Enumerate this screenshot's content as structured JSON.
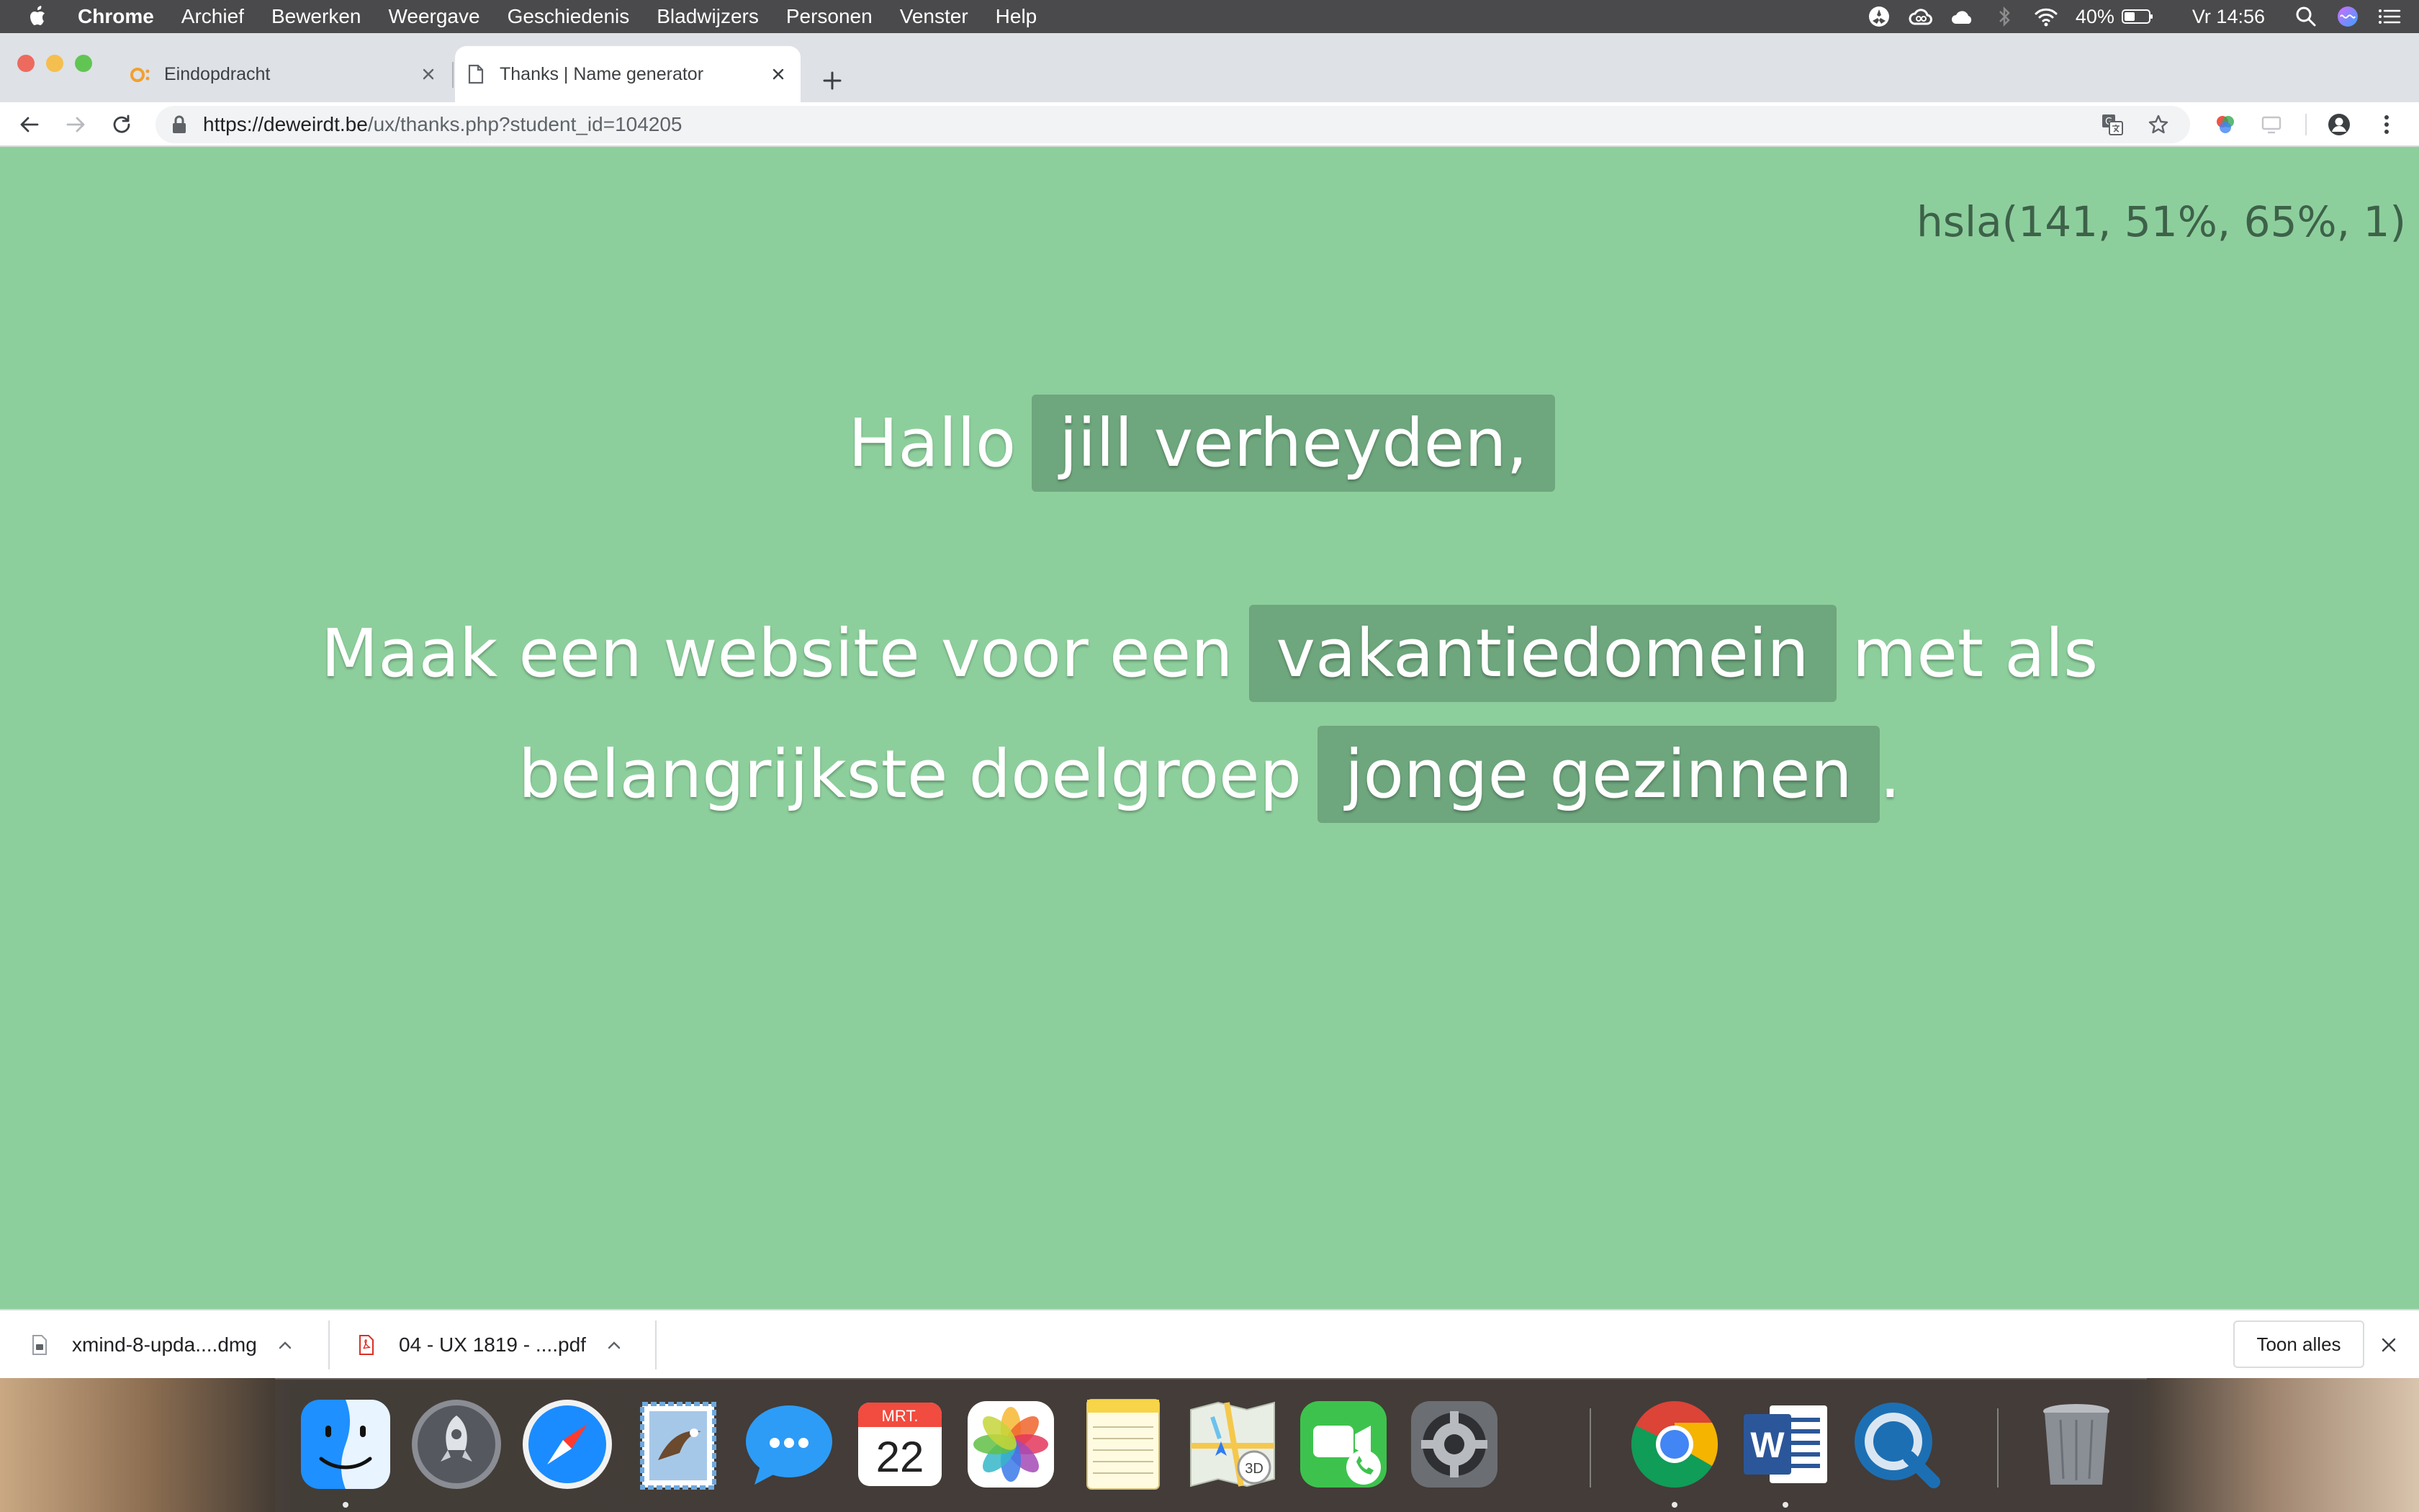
{
  "menubar": {
    "app_name": "Chrome",
    "items": [
      "Archief",
      "Bewerken",
      "Weergave",
      "Geschiedenis",
      "Bladwijzers",
      "Personen",
      "Venster",
      "Help"
    ],
    "battery": "40%",
    "clock": "Vr 14:56"
  },
  "tabs": [
    {
      "title": "Eindopdracht",
      "active": false
    },
    {
      "title": "Thanks | Name generator",
      "active": true
    }
  ],
  "toolbar": {
    "url_host": "https://deweirdt.be",
    "url_path": "/ux/thanks.php?student_id=104205"
  },
  "page": {
    "background_color": "#8dcf9c",
    "color_readout": "hsla(141, 51%, 65%, 1)",
    "greeting": "Hallo",
    "name": "jill verheyden,",
    "sentence_start": "Maak een website voor een",
    "subject": "vakantiedomein",
    "sentence_mid": "met als",
    "sentence_line2": "belangrijkste doelgroep",
    "audience": "jonge gezinnen",
    "sentence_end": "."
  },
  "downloads": {
    "items": [
      {
        "name": "xmind-8-upda....dmg",
        "icon": "dmg-file-icon"
      },
      {
        "name": "04 - UX 1819 - ....pdf",
        "icon": "pdf-file-icon"
      }
    ],
    "show_all_label": "Toon alles"
  },
  "dock": {
    "apps": [
      "finder",
      "launchpad",
      "safari",
      "mail",
      "messages",
      "calendar",
      "photos",
      "notes",
      "maps",
      "facetime",
      "system-preferences",
      "chrome",
      "word",
      "quicktime",
      "trash"
    ],
    "calendar_month": "MRT.",
    "calendar_day": "22"
  }
}
